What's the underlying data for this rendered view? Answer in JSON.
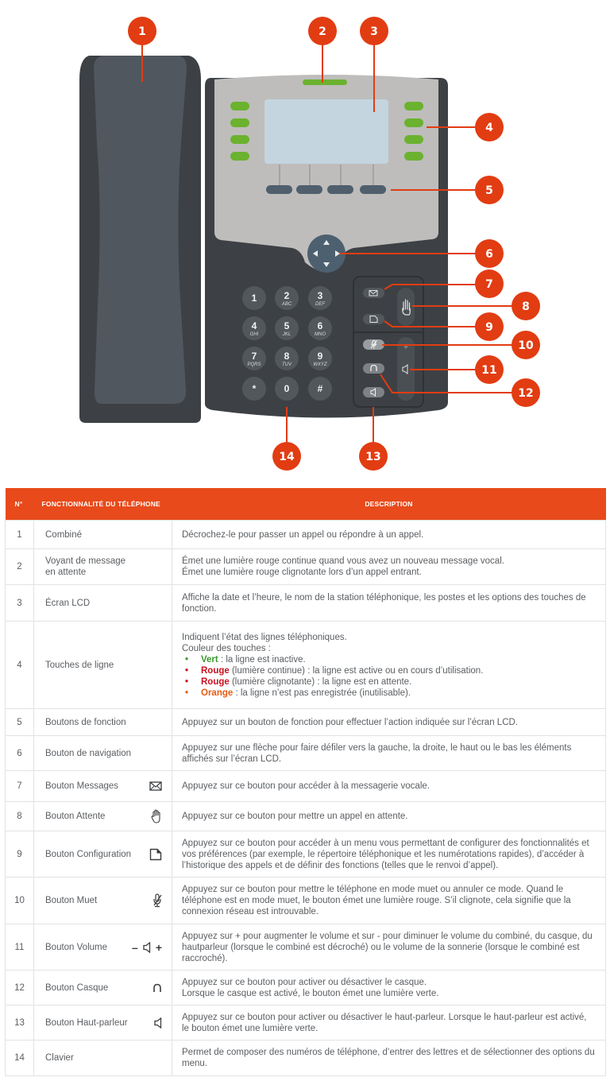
{
  "colors": {
    "accent": "#e84a1b",
    "callout": "#e23c12",
    "phone_dark": "#3d4145",
    "handset": "#50575e",
    "panel_grey": "#bebdbb",
    "lcd": "#c4d5e0",
    "line_key_green": "#6bb22f",
    "function_key": "#4f5f6d",
    "nav_pad": "#4d6070",
    "key_button": "#52575c",
    "status_green": "#3a9a2e",
    "status_red": "#c8101e",
    "status_orange": "#e85a12"
  },
  "diagram": {
    "callouts": [
      "1",
      "2",
      "3",
      "4",
      "5",
      "6",
      "7",
      "8",
      "9",
      "10",
      "11",
      "12",
      "13",
      "14"
    ],
    "keypad": [
      {
        "num": "1",
        "sub": ""
      },
      {
        "num": "2",
        "sub": "ABC"
      },
      {
        "num": "3",
        "sub": "DEF"
      },
      {
        "num": "4",
        "sub": "GHI"
      },
      {
        "num": "5",
        "sub": "JKL"
      },
      {
        "num": "6",
        "sub": "MNO"
      },
      {
        "num": "7",
        "sub": "PQRS"
      },
      {
        "num": "8",
        "sub": "TUV"
      },
      {
        "num": "9",
        "sub": "WXYZ"
      },
      {
        "num": "*",
        "sub": ""
      },
      {
        "num": "0",
        "sub": ""
      },
      {
        "num": "#",
        "sub": ""
      }
    ],
    "volume_plus": "+",
    "volume_minus": "–",
    "nav_arrows": [
      "up",
      "down",
      "left",
      "right"
    ]
  },
  "table": {
    "headers": {
      "num": "N°",
      "feature": "FONCTIONNALITÉ DU TÉLÉPHONE",
      "description": "DESCRIPTION"
    },
    "rows": [
      {
        "num": "1",
        "feature": "Combiné",
        "icon": "",
        "desc": [
          "Décrochez-le pour passer un appel ou répondre à un appel."
        ]
      },
      {
        "num": "2",
        "feature": "Voyant de message en attente",
        "icon": "",
        "desc": [
          "Émet une lumière rouge continue quand vous avez un nouveau message vocal.",
          "Émet une lumière rouge clignotante lors d’un appel entrant."
        ]
      },
      {
        "num": "3",
        "feature": "Écran LCD",
        "icon": "",
        "desc": [
          "Affiche la date et l’heure, le nom de la station téléphonique, les postes et les options des touches de fonction."
        ]
      },
      {
        "num": "4",
        "feature": "Touches de ligne",
        "icon": "",
        "desc": [
          "Indiquent l’état des lignes téléphoniques.",
          "Couleur des touches :"
        ],
        "color_list": [
          {
            "label": "Vert",
            "text": " : la ligne est inactive.",
            "tone": "green"
          },
          {
            "label": "Rouge",
            "text": " (lumière continue) : la ligne est active ou en cours d’utilisation.",
            "tone": "red"
          },
          {
            "label": "Rouge",
            "text": " (lumière clignotante) : la ligne est en attente.",
            "tone": "red"
          },
          {
            "label": "Orange",
            "text": " : la ligne n’est pas enregistrée (inutilisable).",
            "tone": "orange"
          }
        ]
      },
      {
        "num": "5",
        "feature": "Boutons de fonction",
        "icon": "",
        "desc": [
          "Appuyez sur un bouton de fonction pour effectuer l’action indiquée sur l’écran LCD."
        ]
      },
      {
        "num": "6",
        "feature": "Bouton de navigation",
        "icon": "",
        "desc": [
          "Appuyez sur une flèche pour faire défiler vers la gauche, la droite, le haut ou le bas les éléments affichés sur l’écran LCD."
        ]
      },
      {
        "num": "7",
        "feature": "Bouton Messages",
        "icon": "envelope-icon",
        "desc": [
          "Appuyez sur ce bouton pour accéder à la messagerie vocale."
        ]
      },
      {
        "num": "8",
        "feature": "Bouton Attente",
        "icon": "hand-icon",
        "desc": [
          "Appuyez sur ce bouton pour mettre un appel en attente."
        ]
      },
      {
        "num": "9",
        "feature": "Bouton Configuration",
        "icon": "document-icon",
        "desc": [
          "Appuyez sur ce bouton pour accéder à un menu vous permettant de configurer des fonctionnalités et vos préférences (par exemple, le répertoire téléphonique et les numérotations rapides), d’accéder à l’historique des appels et de définir des fonctions (telles que le renvoi d’appel)."
        ]
      },
      {
        "num": "10",
        "feature": "Bouton Muet",
        "icon": "muted-mic-icon",
        "desc": [
          "Appuyez sur ce bouton pour mettre le téléphone en mode muet ou annuler ce mode. Quand le téléphone est en mode muet, le bouton émet une lumière rouge. S’il clignote, cela signifie que la connexion réseau est introuvable."
        ]
      },
      {
        "num": "11",
        "feature": "Bouton Volume",
        "icon": "volume-icon",
        "icon_minus": "–",
        "icon_plus": "+",
        "desc": [
          "Appuyez sur + pour augmenter le volume et sur - pour diminuer le volume du combiné, du casque, du hautparleur (lorsque le combiné est décroché) ou le volume de la sonnerie (lorsque le combiné est raccroché)."
        ]
      },
      {
        "num": "12",
        "feature": "Bouton Casque",
        "icon": "headset-icon",
        "desc": [
          "Appuyez sur ce bouton pour activer ou désactiver le casque.",
          "Lorsque le casque est activé, le bouton émet une lumière verte."
        ]
      },
      {
        "num": "13",
        "feature": "Bouton Haut-parleur",
        "icon": "speaker-icon",
        "desc": [
          "Appuyez sur ce bouton pour activer ou désactiver le haut-parleur. Lorsque le haut-parleur est activé, le bouton émet une lumière verte."
        ]
      },
      {
        "num": "14",
        "feature": "Clavier",
        "icon": "",
        "desc": [
          "Permet de composer des numéros de téléphone, d’entrer des lettres et de sélectionner des options du menu."
        ]
      }
    ]
  }
}
